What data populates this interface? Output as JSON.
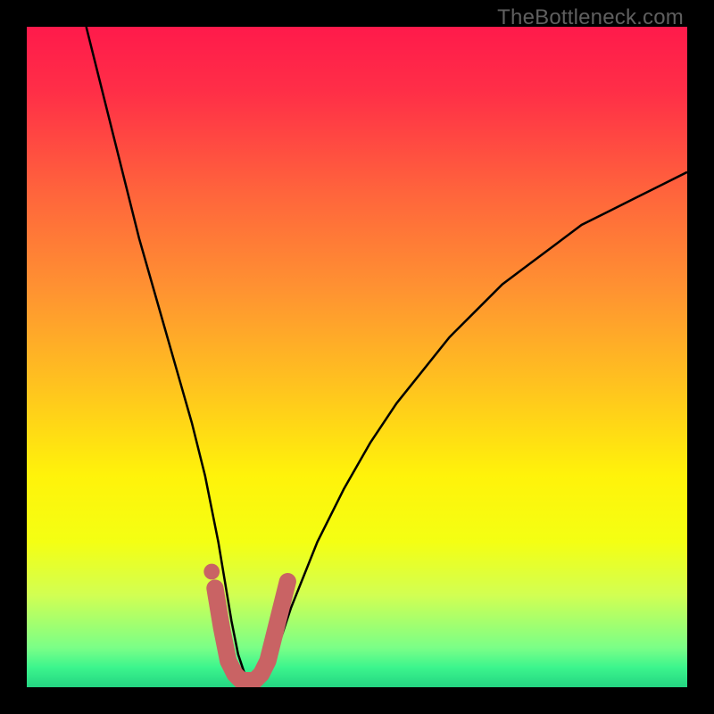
{
  "watermark": "TheBottleneck.com",
  "gradient_stops": [
    {
      "offset": 0.0,
      "color": "#ff1a4b"
    },
    {
      "offset": 0.1,
      "color": "#ff2f47"
    },
    {
      "offset": 0.25,
      "color": "#ff643c"
    },
    {
      "offset": 0.4,
      "color": "#ff9331"
    },
    {
      "offset": 0.55,
      "color": "#ffc51e"
    },
    {
      "offset": 0.68,
      "color": "#fff30a"
    },
    {
      "offset": 0.78,
      "color": "#f4ff13"
    },
    {
      "offset": 0.86,
      "color": "#d2ff52"
    },
    {
      "offset": 0.94,
      "color": "#7bff87"
    },
    {
      "offset": 0.97,
      "color": "#3cf58d"
    },
    {
      "offset": 1.0,
      "color": "#24d582"
    }
  ],
  "chart_data": {
    "type": "line",
    "title": "",
    "xlabel": "",
    "ylabel": "",
    "xlim": [
      0,
      100
    ],
    "ylim": [
      0,
      100
    ],
    "series": [
      {
        "name": "bottleneck-curve",
        "color": "#000000",
        "x": [
          9,
          11,
          13,
          15,
          17,
          19,
          21,
          23,
          25,
          26,
          27,
          28,
          29,
          30,
          31,
          32,
          33,
          34,
          35,
          36,
          38,
          40,
          44,
          48,
          52,
          56,
          60,
          64,
          68,
          72,
          76,
          80,
          84,
          88,
          92,
          96,
          100
        ],
        "values": [
          100,
          92,
          84,
          76,
          68,
          61,
          54,
          47,
          40,
          36,
          32,
          27,
          22,
          16,
          10,
          5,
          2,
          1,
          1,
          2,
          6,
          12,
          22,
          30,
          37,
          43,
          48,
          53,
          57,
          61,
          64,
          67,
          70,
          72,
          74,
          76,
          78
        ]
      },
      {
        "name": "highlight-band",
        "color": "#c96364",
        "x": [
          28.5,
          29.5,
          30.5,
          31.5,
          32.5,
          33.5,
          34.5,
          35.5,
          36.5,
          37.5,
          38.5,
          39.5
        ],
        "values": [
          15,
          9,
          4,
          2,
          1,
          1,
          1,
          2,
          4,
          8,
          12,
          16
        ]
      }
    ],
    "markers": [
      {
        "name": "highlight-dot",
        "x": 28.0,
        "y": 17.5,
        "color": "#c96364",
        "r": 1.2
      }
    ]
  }
}
